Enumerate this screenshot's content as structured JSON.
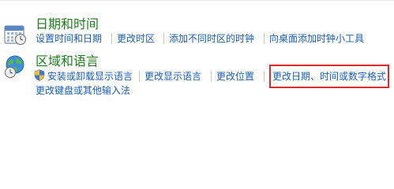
{
  "categories": [
    {
      "title": "日期和时间",
      "icon": "calendar-clock-icon",
      "links": [
        "设置时间和日期",
        "更改时区",
        "添加不同时区的时钟",
        "向桌面添加时钟小工具"
      ]
    },
    {
      "title": "区域和语言",
      "icon": "globe-clock-icon",
      "links": [
        "安装或卸载显示语言",
        "更改显示语言",
        "更改位置",
        "更改日期、时间或数字格式",
        "更改键盘或其他输入法"
      ],
      "admin_icon": "uac-shield-icon"
    }
  ],
  "annotation": {
    "highlight_color": "#e02b2b",
    "highlighted_link": "更改日期、时间或数字格式"
  },
  "colors": {
    "title": "#1e7e1e",
    "link": "#1a5fb4",
    "separator": "#c4c4c4"
  }
}
